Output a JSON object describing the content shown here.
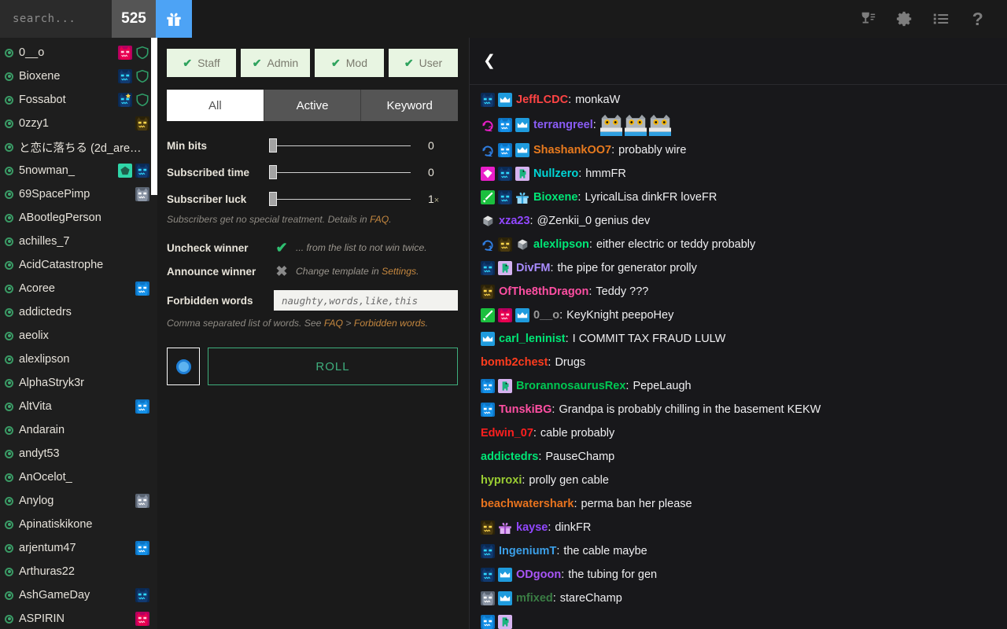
{
  "topbar": {
    "search_placeholder": "search...",
    "search_value": "",
    "count": "525",
    "gift_icon": "gift-icon",
    "icons": [
      {
        "name": "trophy-list-icon",
        "glyph": "trophy"
      },
      {
        "name": "gear-icon",
        "glyph": "gear"
      },
      {
        "name": "list-icon",
        "glyph": "list"
      },
      {
        "name": "help-icon",
        "glyph": "?"
      }
    ]
  },
  "userlist": {
    "users": [
      {
        "name": "0__o",
        "badges": [
          "cat-magenta",
          "shield-green"
        ]
      },
      {
        "name": "Bioxene",
        "badges": [
          "cat-blue-dark",
          "shield-green"
        ]
      },
      {
        "name": "Fossabot",
        "badges": [
          "cat-star",
          "shield-green"
        ]
      },
      {
        "name": "0zzy1",
        "badges": [
          "cat-gold"
        ]
      },
      {
        "name": "と恋に落ちる (2d_are_be...",
        "badges": []
      },
      {
        "name": "5nowman_",
        "badges": [
          "pentagon-teal",
          "cat-blue-dark"
        ]
      },
      {
        "name": "69SpacePimp",
        "badges": [
          "cat-grey"
        ]
      },
      {
        "name": "ABootlegPerson",
        "badges": []
      },
      {
        "name": "achilles_7",
        "badges": []
      },
      {
        "name": "AcidCatastrophe",
        "badges": []
      },
      {
        "name": "Acoree",
        "badges": [
          "cat-cyan"
        ]
      },
      {
        "name": "addictedrs",
        "badges": []
      },
      {
        "name": "aeolix",
        "badges": []
      },
      {
        "name": "alexlipson",
        "badges": []
      },
      {
        "name": "AlphaStryk3r",
        "badges": []
      },
      {
        "name": "AltVita",
        "badges": [
          "cat-cyan"
        ]
      },
      {
        "name": "Andarain",
        "badges": []
      },
      {
        "name": "andyt53",
        "badges": []
      },
      {
        "name": "AnOcelot_",
        "badges": []
      },
      {
        "name": "Anylog",
        "badges": [
          "cat-grey"
        ]
      },
      {
        "name": "Apinatiskikone",
        "badges": []
      },
      {
        "name": "arjentum47",
        "badges": [
          "cat-cyan"
        ]
      },
      {
        "name": "Arthuras22",
        "badges": []
      },
      {
        "name": "AshGameDay",
        "badges": [
          "cat-blue-dark"
        ]
      },
      {
        "name": "ASPIRIN",
        "badges": [
          "cat-magenta"
        ]
      }
    ]
  },
  "middle": {
    "roles": [
      {
        "label": "Staff",
        "checked": true
      },
      {
        "label": "Admin",
        "checked": true
      },
      {
        "label": "Mod",
        "checked": true
      },
      {
        "label": "User",
        "checked": true
      }
    ],
    "tabs": [
      {
        "label": "All",
        "active": true
      },
      {
        "label": "Active",
        "active": false
      },
      {
        "label": "Keyword",
        "active": false
      }
    ],
    "sliders": [
      {
        "label": "Min bits",
        "value": "0",
        "suffix": ""
      },
      {
        "label": "Subscribed time",
        "value": "0",
        "suffix": ""
      },
      {
        "label": "Subscriber luck",
        "value": "1",
        "suffix": "×"
      }
    ],
    "sub_hint_prefix": "Subscribers get no special treatment. Details in ",
    "sub_hint_link": "FAQ",
    "sub_hint_suffix": ".",
    "uncheck_winner": {
      "label": "Uncheck winner",
      "mark": "✔",
      "note": "... from the list to not win twice."
    },
    "announce_winner": {
      "label": "Announce winner",
      "mark": "✖",
      "note_prefix": "Change template in ",
      "note_link": "Settings",
      "note_suffix": "."
    },
    "forbidden": {
      "label": "Forbidden words",
      "placeholder": "naughty,words,like,this",
      "value": "",
      "hint_prefix": "Comma separated list of words. See ",
      "hint_link1": "FAQ",
      "hint_mid": " > ",
      "hint_link2": "Forbidden words",
      "hint_suffix": "."
    },
    "roll_toggle_icon": "record-toggle-icon",
    "roll_label": "ROLL"
  },
  "chat": {
    "back_icon": "chevron-left-icon",
    "messages": [
      {
        "badges": [
          "cat-blue-dark",
          "crown-blue"
        ],
        "user": "JeffLCDC",
        "color": "#ff4444",
        "text": "monkaW",
        "emotes": 0
      },
      {
        "badges": [
          "sub-pink-2",
          "cat-cyan",
          "crown-blue"
        ],
        "user": "terrangreel",
        "color": "#8a5cf6",
        "text": "",
        "emotes": 3
      },
      {
        "badges": [
          "sub-blue-1",
          "cat-cyan",
          "crown-blue"
        ],
        "user": "ShashankOO7",
        "color": "#e87a1e",
        "text": "probably wire",
        "emotes": 0
      },
      {
        "badges": [
          "gem-pink",
          "cat-blue-dark",
          "dino-lilac"
        ],
        "user": "Nullzero",
        "color": "#00d6d6",
        "text": "hmmFR",
        "emotes": 0
      },
      {
        "badges": [
          "sword-green",
          "cat-blue-dark",
          "gift-blue"
        ],
        "user": "Bioxene",
        "color": "#00e676",
        "text": "LyricalLisa dinkFR loveFR",
        "emotes": 0
      },
      {
        "badges": [
          "dice-grey"
        ],
        "user": "xza23",
        "color": "#9147ff",
        "text": "@Zenkii_0 genius dev",
        "emotes": 0
      },
      {
        "badges": [
          "sub-blue-1",
          "cat-gold",
          "dice-grey"
        ],
        "user": "alexlipson",
        "color": "#00e676",
        "text": "either electric or teddy probably",
        "emotes": 0
      },
      {
        "badges": [
          "cat-blue-dark",
          "dino-lilac"
        ],
        "user": "DivFM",
        "color": "#a98cff",
        "text": "the pipe for generator prolly",
        "emotes": 0
      },
      {
        "badges": [
          "cat-gold"
        ],
        "user": "OfThe8thDragon",
        "color": "#ff4fa3",
        "text": "Teddy ???",
        "emotes": 0
      },
      {
        "badges": [
          "sword-green",
          "cat-magenta",
          "crown-blue"
        ],
        "user": "0__o",
        "color": "#999999",
        "text": "KeyKnight peepoHey",
        "emotes": 0
      },
      {
        "badges": [
          "crown-blue"
        ],
        "user": "carl_leninist",
        "color": "#00e676",
        "text": "I COMMIT TAX FRAUD LULW",
        "emotes": 0
      },
      {
        "badges": [],
        "user": "bomb2chest",
        "color": "#ff3c1e",
        "text": "Drugs",
        "emotes": 0
      },
      {
        "badges": [
          "cat-cyan",
          "dino-lilac"
        ],
        "user": "BrorannosaurusRex",
        "color": "#00c853",
        "text": "PepeLaugh",
        "emotes": 0
      },
      {
        "badges": [
          "cat-cyan"
        ],
        "user": "TunskiBG",
        "color": "#ff4fa3",
        "text": "Grandpa is probably chilling in the basement KEKW",
        "emotes": 0
      },
      {
        "badges": [],
        "user": "Edwin_07",
        "color": "#ff1f1f",
        "text": "cable probably",
        "emotes": 0
      },
      {
        "badges": [],
        "user": "addictedrs",
        "color": "#00e676",
        "text": "PauseChamp",
        "emotes": 0
      },
      {
        "badges": [],
        "user": "hyproxi",
        "color": "#9acd32",
        "text": "prolly gen cable",
        "emotes": 0
      },
      {
        "badges": [],
        "user": "beachwatershark",
        "color": "#e8731e",
        "text": "perma ban her please",
        "emotes": 0
      },
      {
        "badges": [
          "cat-gold",
          "gift-purple"
        ],
        "user": "kayse",
        "color": "#9147ff",
        "text": "dinkFR",
        "emotes": 0
      },
      {
        "badges": [
          "cat-blue-dark"
        ],
        "user": "IngeniumT",
        "color": "#3b9fe8",
        "text": "the cable maybe",
        "emotes": 0
      },
      {
        "badges": [
          "cat-blue-dark",
          "crown-blue"
        ],
        "user": "ODgoon",
        "color": "#a855f7",
        "text": "the tubing for gen",
        "emotes": 0
      },
      {
        "badges": [
          "cat-grey",
          "crown-blue"
        ],
        "user": "mfixed",
        "color": "#3a7d44",
        "text": "stareChamp",
        "emotes": 0
      },
      {
        "badges": [
          "cat-cyan",
          "dino-lilac"
        ],
        "user": "",
        "color": "#3b9fe8",
        "text": "",
        "emotes": 0
      }
    ]
  }
}
